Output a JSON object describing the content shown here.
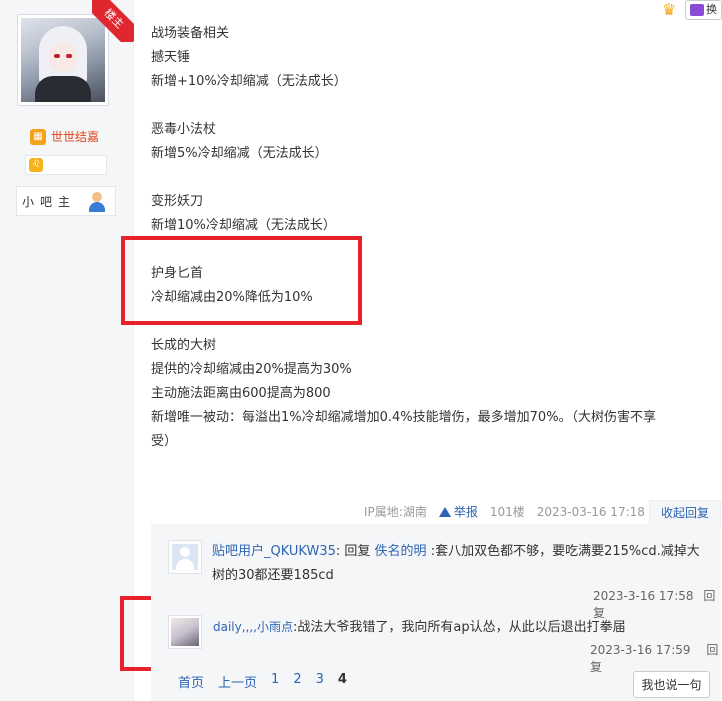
{
  "sidebar": {
    "corner_badge": "楼主",
    "user_name": "世世结嘉",
    "level_icon_text": "",
    "zodiac_icon_text": "♌",
    "role": "小吧主"
  },
  "top_right": {
    "switch_label": "换"
  },
  "post": {
    "lines": [
      "战场装备相关",
      "撼天锤",
      "新增+10%冷却缩减（无法成长）",
      "",
      "恶毒小法杖",
      "新增5%冷却缩减（无法成长）",
      "",
      "变形妖刀",
      "新增10%冷却缩减（无法成长）",
      "",
      "护身匕首",
      "冷却缩减由20%降低为10%",
      "",
      "长成的大树",
      "提供的冷却缩减由20%提高为30%",
      "主动施法距离由600提高为800",
      "新增唯一被动：每溢出1%冷却缩减增加0.4%技能增伤，最多增加70%。（大树伤害不享",
      "受）"
    ]
  },
  "meta": {
    "ip": "IP属地:湖南",
    "report": "举报",
    "floor": "101楼",
    "time": "2023-03-16 17:18",
    "collapse": "收起回复"
  },
  "replies": [
    {
      "user": "贴吧用户_QKUKW35",
      "prefix": ": 回复 ",
      "target": "佚名的明",
      "text": " :套八加双色都不够，要吃满要215%cd.减掉大树的30都还要185cd",
      "time": "2023-3-16 17:58",
      "reply_label": "回复"
    },
    {
      "user": "daily,,,,小雨点",
      "text": ":战法大爷我错了，我向所有ap认怂，从此以后退出打拳届",
      "time": "2023-3-16 17:59",
      "reply_label": "回复"
    }
  ],
  "pager": {
    "first": "首页",
    "prev": "上一页",
    "pages": [
      "1",
      "2",
      "3"
    ],
    "current": "4"
  },
  "say_button": "我也说一句",
  "colors": {
    "highlight": "#e8222a",
    "link": "#2d64b3",
    "username": "#e0461c"
  }
}
